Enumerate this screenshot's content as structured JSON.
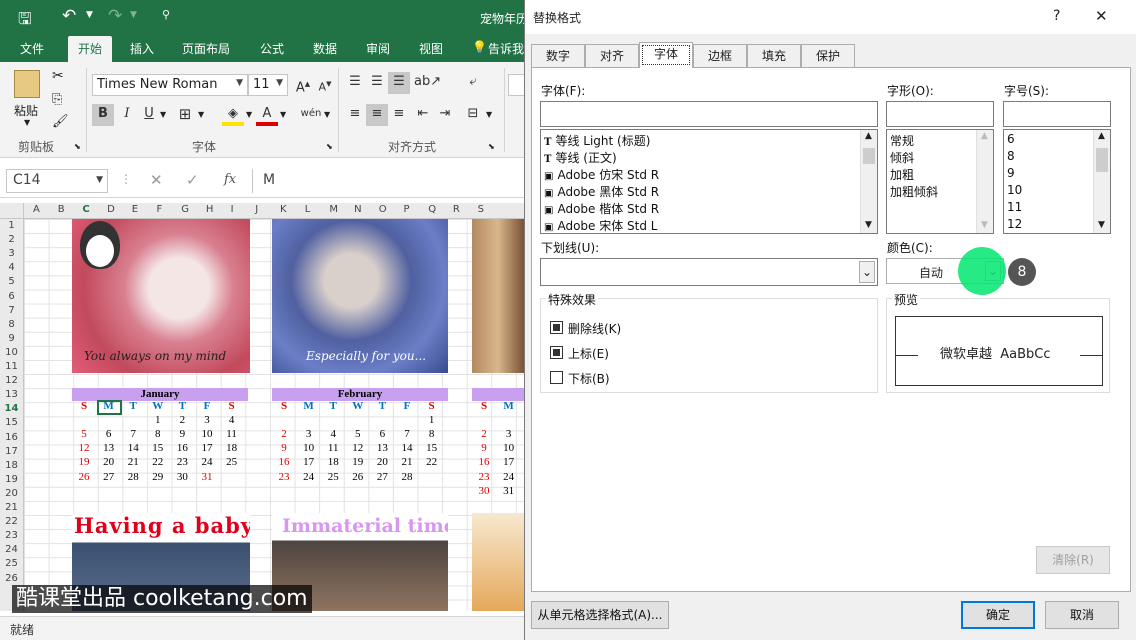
{
  "excel": {
    "title": "宠物年历",
    "tabs": [
      "文件",
      "开始",
      "插入",
      "页面布局",
      "公式",
      "数据",
      "审阅",
      "视图",
      "告诉我"
    ],
    "active_tab": "开始",
    "font_name": "Times New Roman",
    "font_size": "11",
    "paste_label": "粘贴",
    "groups": [
      "剪贴板",
      "字体",
      "对齐方式"
    ],
    "name_box": "C14",
    "formula_value": "M",
    "fx_label": "fx",
    "columns": [
      "A",
      "B",
      "C",
      "D",
      "E",
      "F",
      "G",
      "H",
      "I",
      "J",
      "K",
      "L",
      "M",
      "N",
      "O",
      "P",
      "Q",
      "R",
      "S"
    ],
    "rows": [
      "1",
      "2",
      "3",
      "4",
      "5",
      "6",
      "7",
      "8",
      "9",
      "10",
      "11",
      "12",
      "13",
      "14",
      "15",
      "16",
      "17",
      "18",
      "19",
      "20",
      "21",
      "22",
      "23",
      "24",
      "25",
      "26"
    ],
    "status": "就绪",
    "captions": [
      "You always on my mind",
      "Especially for you...",
      "Having a baby",
      "Immaterial time"
    ],
    "jan": {
      "name": "January",
      "days": [
        "S",
        "M",
        "T",
        "W",
        "T",
        "F",
        "S"
      ],
      "weeks": [
        [
          "",
          "",
          "",
          "1",
          "2",
          "3",
          "4"
        ],
        [
          "5",
          "6",
          "7",
          "8",
          "9",
          "10",
          "11"
        ],
        [
          "12",
          "13",
          "14",
          "15",
          "16",
          "17",
          "18"
        ],
        [
          "19",
          "20",
          "21",
          "22",
          "23",
          "24",
          "25"
        ],
        [
          "26",
          "27",
          "28",
          "29",
          "30",
          "31",
          ""
        ]
      ]
    },
    "feb": {
      "name": "February",
      "days": [
        "S",
        "M",
        "T",
        "W",
        "T",
        "F",
        "S"
      ],
      "weeks": [
        [
          "",
          "",
          "",
          "",
          "",
          "",
          "1"
        ],
        [
          "2",
          "3",
          "4",
          "5",
          "6",
          "7",
          "8"
        ],
        [
          "9",
          "10",
          "11",
          "12",
          "13",
          "14",
          "15"
        ],
        [
          "16",
          "17",
          "18",
          "19",
          "20",
          "21",
          "22"
        ],
        [
          "23",
          "24",
          "25",
          "26",
          "27",
          "28",
          ""
        ]
      ]
    },
    "mar": {
      "days": [
        "S",
        "M"
      ],
      "weeks": [
        [
          "",
          ""
        ],
        [
          "2",
          "3"
        ],
        [
          "9",
          "10"
        ],
        [
          "16",
          "17"
        ],
        [
          "23",
          "24"
        ],
        [
          "30",
          "31"
        ]
      ]
    },
    "watermark": "酷课堂出品 coolketang.com"
  },
  "dialog": {
    "title": "替换格式",
    "help": "?",
    "close": "✕",
    "tabs": [
      "数字",
      "对齐",
      "字体",
      "边框",
      "填充",
      "保护"
    ],
    "active_tab": "字体",
    "font_label": "字体(F):",
    "style_label": "字形(O):",
    "size_label": "字号(S):",
    "fonts": [
      "等线 Light (标题)",
      "等线 (正文)",
      "Adobe 仿宋 Std R",
      "Adobe 黑体 Std R",
      "Adobe 楷体 Std R",
      "Adobe 宋体 Std L"
    ],
    "styles": [
      "常规",
      "倾斜",
      "加粗",
      "加粗倾斜"
    ],
    "sizes": [
      "6",
      "8",
      "9",
      "10",
      "11",
      "12"
    ],
    "underline_label": "下划线(U):",
    "color_label": "颜色(C):",
    "color_value": "自动",
    "step_badge": "8",
    "effects_label": "特殊效果",
    "strikethrough": "删除线(K)",
    "superscript": "上标(E)",
    "subscript": "下标(B)",
    "preview_label": "预览",
    "preview_text": "微软卓越  AaBbCc",
    "clear_button": "清除(R)",
    "choose_button": "从单元格选择格式(A)...",
    "ok_button": "确定",
    "cancel_button": "取消"
  }
}
